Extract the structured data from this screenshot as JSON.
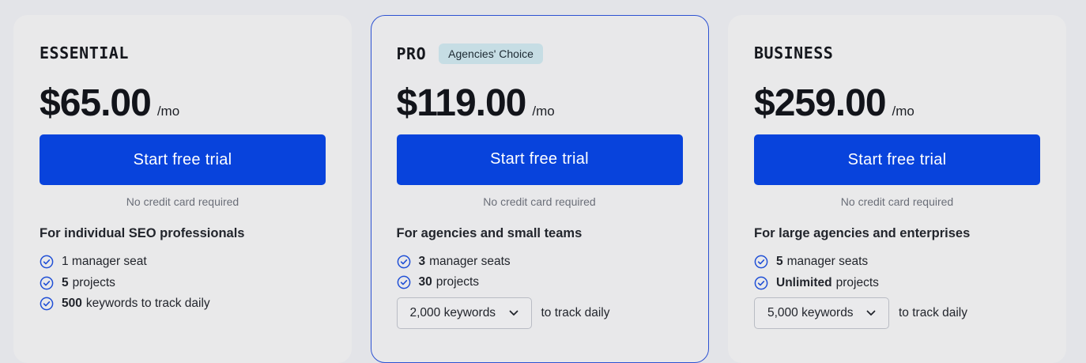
{
  "plans": [
    {
      "name": "ESSENTIAL",
      "badge": "",
      "price": "$65.00",
      "period": "/mo",
      "cta": "Start free trial",
      "note": "No credit card required",
      "audience": "For individual SEO professionals",
      "features": [
        {
          "bold": "",
          "text": "1 manager seat"
        },
        {
          "bold": "5",
          "text": "projects"
        },
        {
          "bold": "500",
          "text": "keywords to track daily"
        }
      ]
    },
    {
      "name": "PRO",
      "badge": "Agencies' Choice",
      "price": "$119.00",
      "period": "/mo",
      "cta": "Start free trial",
      "note": "No credit card required",
      "audience": "For agencies and small teams",
      "features": [
        {
          "bold": "3",
          "text": "manager seats"
        },
        {
          "bold": "30",
          "text": "projects"
        }
      ],
      "keywords_select": "2,000 keywords",
      "keywords_suffix": "to track daily"
    },
    {
      "name": "BUSINESS",
      "badge": "",
      "price": "$259.00",
      "period": "/mo",
      "cta": "Start free trial",
      "note": "No credit card required",
      "audience": "For large agencies and enterprises",
      "features": [
        {
          "bold": "5",
          "text": "manager seats"
        },
        {
          "bold": "Unlimited",
          "text": "projects"
        }
      ],
      "keywords_select": "5,000 keywords",
      "keywords_suffix": "to track daily"
    }
  ],
  "colors": {
    "accent": "#0843dc",
    "highlight_border": "#2d52d2",
    "badge_bg": "#c6dde4",
    "check": "#1f4fd6",
    "page_bg": "#e3e4e8",
    "card_bg": "#e9e9ea"
  },
  "icons": {
    "feature": "check-circle-icon",
    "dropdown": "chevron-down-icon"
  }
}
